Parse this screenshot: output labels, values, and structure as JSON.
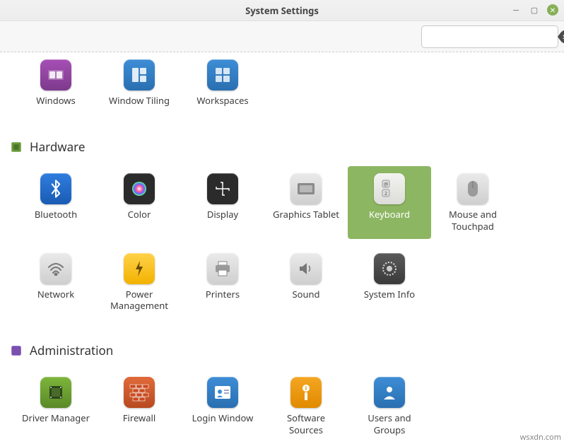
{
  "window": {
    "title": "System Settings"
  },
  "search": {
    "placeholder": "",
    "value": ""
  },
  "partial_section": {
    "items": [
      {
        "label": "Windows"
      },
      {
        "label": "Window Tiling"
      },
      {
        "label": "Workspaces"
      }
    ]
  },
  "hardware": {
    "title": "Hardware",
    "items": [
      {
        "label": "Bluetooth"
      },
      {
        "label": "Color"
      },
      {
        "label": "Display"
      },
      {
        "label": "Graphics Tablet"
      },
      {
        "label": "Keyboard",
        "selected": true
      },
      {
        "label": "Mouse and Touchpad"
      },
      {
        "label": "Network"
      },
      {
        "label": "Power Management"
      },
      {
        "label": "Printers"
      },
      {
        "label": "Sound"
      },
      {
        "label": "System Info"
      }
    ]
  },
  "administration": {
    "title": "Administration",
    "items": [
      {
        "label": "Driver Manager"
      },
      {
        "label": "Firewall"
      },
      {
        "label": "Login Window"
      },
      {
        "label": "Software Sources"
      },
      {
        "label": "Users and Groups"
      }
    ]
  },
  "watermark": "wsxdn.com"
}
